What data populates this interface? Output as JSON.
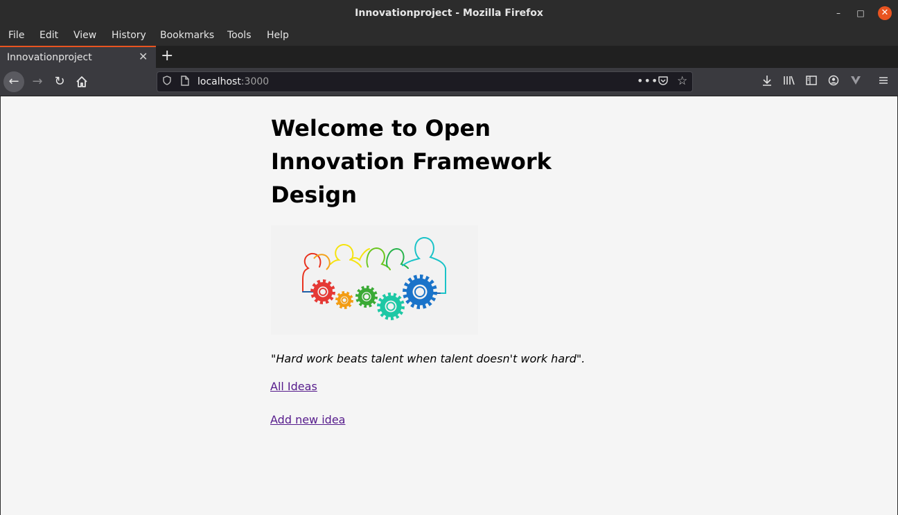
{
  "window": {
    "title": "Innovationproject - Mozilla Firefox"
  },
  "menu": {
    "items": [
      "File",
      "Edit",
      "View",
      "History",
      "Bookmarks",
      "Tools",
      "Help"
    ]
  },
  "tab": {
    "label": "Innovationproject"
  },
  "url": {
    "host": "localhost",
    "port": ":3000"
  },
  "page": {
    "title": "Welcome to Open Innovation Framework Design",
    "quote": "\"Hard work beats talent when talent doesn't work hard\".",
    "links": [
      "All Ideas",
      "Add new idea"
    ]
  },
  "colors": {
    "accent": "#e95420",
    "link_visited": "#551a8b"
  },
  "hero": {
    "people_colors": [
      "#e8321e",
      "#f3a21b",
      "#f5e30f",
      "#6cc61f",
      "#27b34b",
      "#1ac3c8",
      "#1d5fa8"
    ],
    "gear_colors": [
      "#e53935",
      "#f39c12",
      "#3aaa35",
      "#1ec8a5",
      "#1a73c9"
    ]
  }
}
